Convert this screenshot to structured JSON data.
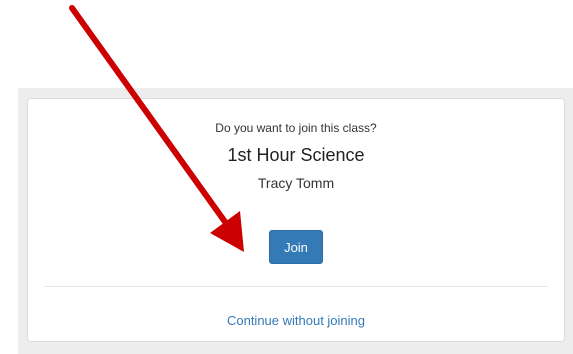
{
  "dialog": {
    "question": "Do you want to join this class?",
    "class_name": "1st Hour Science",
    "teacher": "Tracy Tomm",
    "join_label": "Join",
    "continue_label": "Continue without joining"
  },
  "colors": {
    "primary": "#337ab7",
    "arrow": "#cc0000",
    "background_band": "#ededed"
  }
}
